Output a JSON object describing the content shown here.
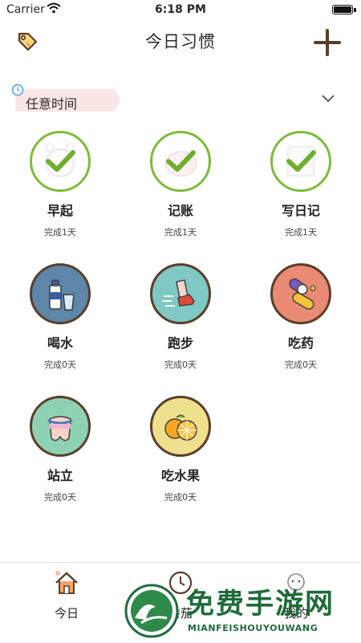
{
  "status_bar": {
    "carrier": "Carrier",
    "time": "6:18 PM"
  },
  "nav": {
    "title": "今日习惯",
    "left_icon": "tag-icon",
    "right_icon": "plus-icon"
  },
  "filter": {
    "label": "任意时间",
    "icon": "clock-icon"
  },
  "habits": [
    {
      "name": "早起",
      "status": "完成1天",
      "done": true,
      "icon": "alarm-clock"
    },
    {
      "name": "记账",
      "status": "完成1天",
      "done": true,
      "icon": "piggy-bank"
    },
    {
      "name": "写日记",
      "status": "完成1天",
      "done": true,
      "icon": "notebook"
    },
    {
      "name": "喝水",
      "status": "完成0天",
      "done": false,
      "icon": "water-bottle"
    },
    {
      "name": "跑步",
      "status": "完成0天",
      "done": false,
      "icon": "running-shoe"
    },
    {
      "name": "吃药",
      "status": "完成0天",
      "done": false,
      "icon": "pills"
    },
    {
      "name": "站立",
      "status": "完成0天",
      "done": false,
      "icon": "standing-body"
    },
    {
      "name": "吃水果",
      "status": "完成0天",
      "done": false,
      "icon": "orange-fruit"
    }
  ],
  "colors": {
    "done_ring": "#7dbb3c",
    "check": "#6fae2f",
    "drink_bg": "#5e86a8",
    "run_bg": "#7fc8c4",
    "pill_bg": "#e98a74",
    "stand_bg": "#8fd1b3",
    "fruit_bg": "#efe08d"
  },
  "tabbar": {
    "today": "今日",
    "middle": "番茄",
    "mine": "我的"
  },
  "watermark": {
    "title": "免费手游网",
    "subtitle": "MIANFEISHOUYOUWANG"
  }
}
